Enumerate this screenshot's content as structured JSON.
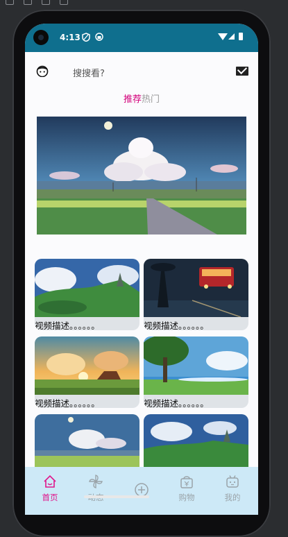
{
  "status_bar": {
    "time": "4:13"
  },
  "header": {
    "search_placeholder": "搜搜看?"
  },
  "tabs": [
    {
      "label": "推荐",
      "active": true
    },
    {
      "label": "热门",
      "active": false
    }
  ],
  "feed": {
    "items": [
      {
        "description": "视频描述。。。。。。"
      },
      {
        "description": "视频描述。。。。。。"
      },
      {
        "description": "视频描述。。。。。。"
      },
      {
        "description": "视频描述。。。。。。"
      },
      {
        "description": ""
      },
      {
        "description": ""
      }
    ]
  },
  "bottom_nav": {
    "items": [
      {
        "label": "首页",
        "icon": "home-icon",
        "active": true
      },
      {
        "label": "动态",
        "icon": "pinwheel-icon",
        "active": false
      },
      {
        "label": "",
        "icon": "plus-circle-icon",
        "active": false
      },
      {
        "label": "购物",
        "icon": "shopping-bag-icon",
        "active": false
      },
      {
        "label": "我的",
        "icon": "profile-icon",
        "active": false
      }
    ]
  },
  "colors": {
    "status_bar": "#0f6f8e",
    "accent": "#d3007a",
    "bottom_nav_bg": "#cde9f7"
  }
}
